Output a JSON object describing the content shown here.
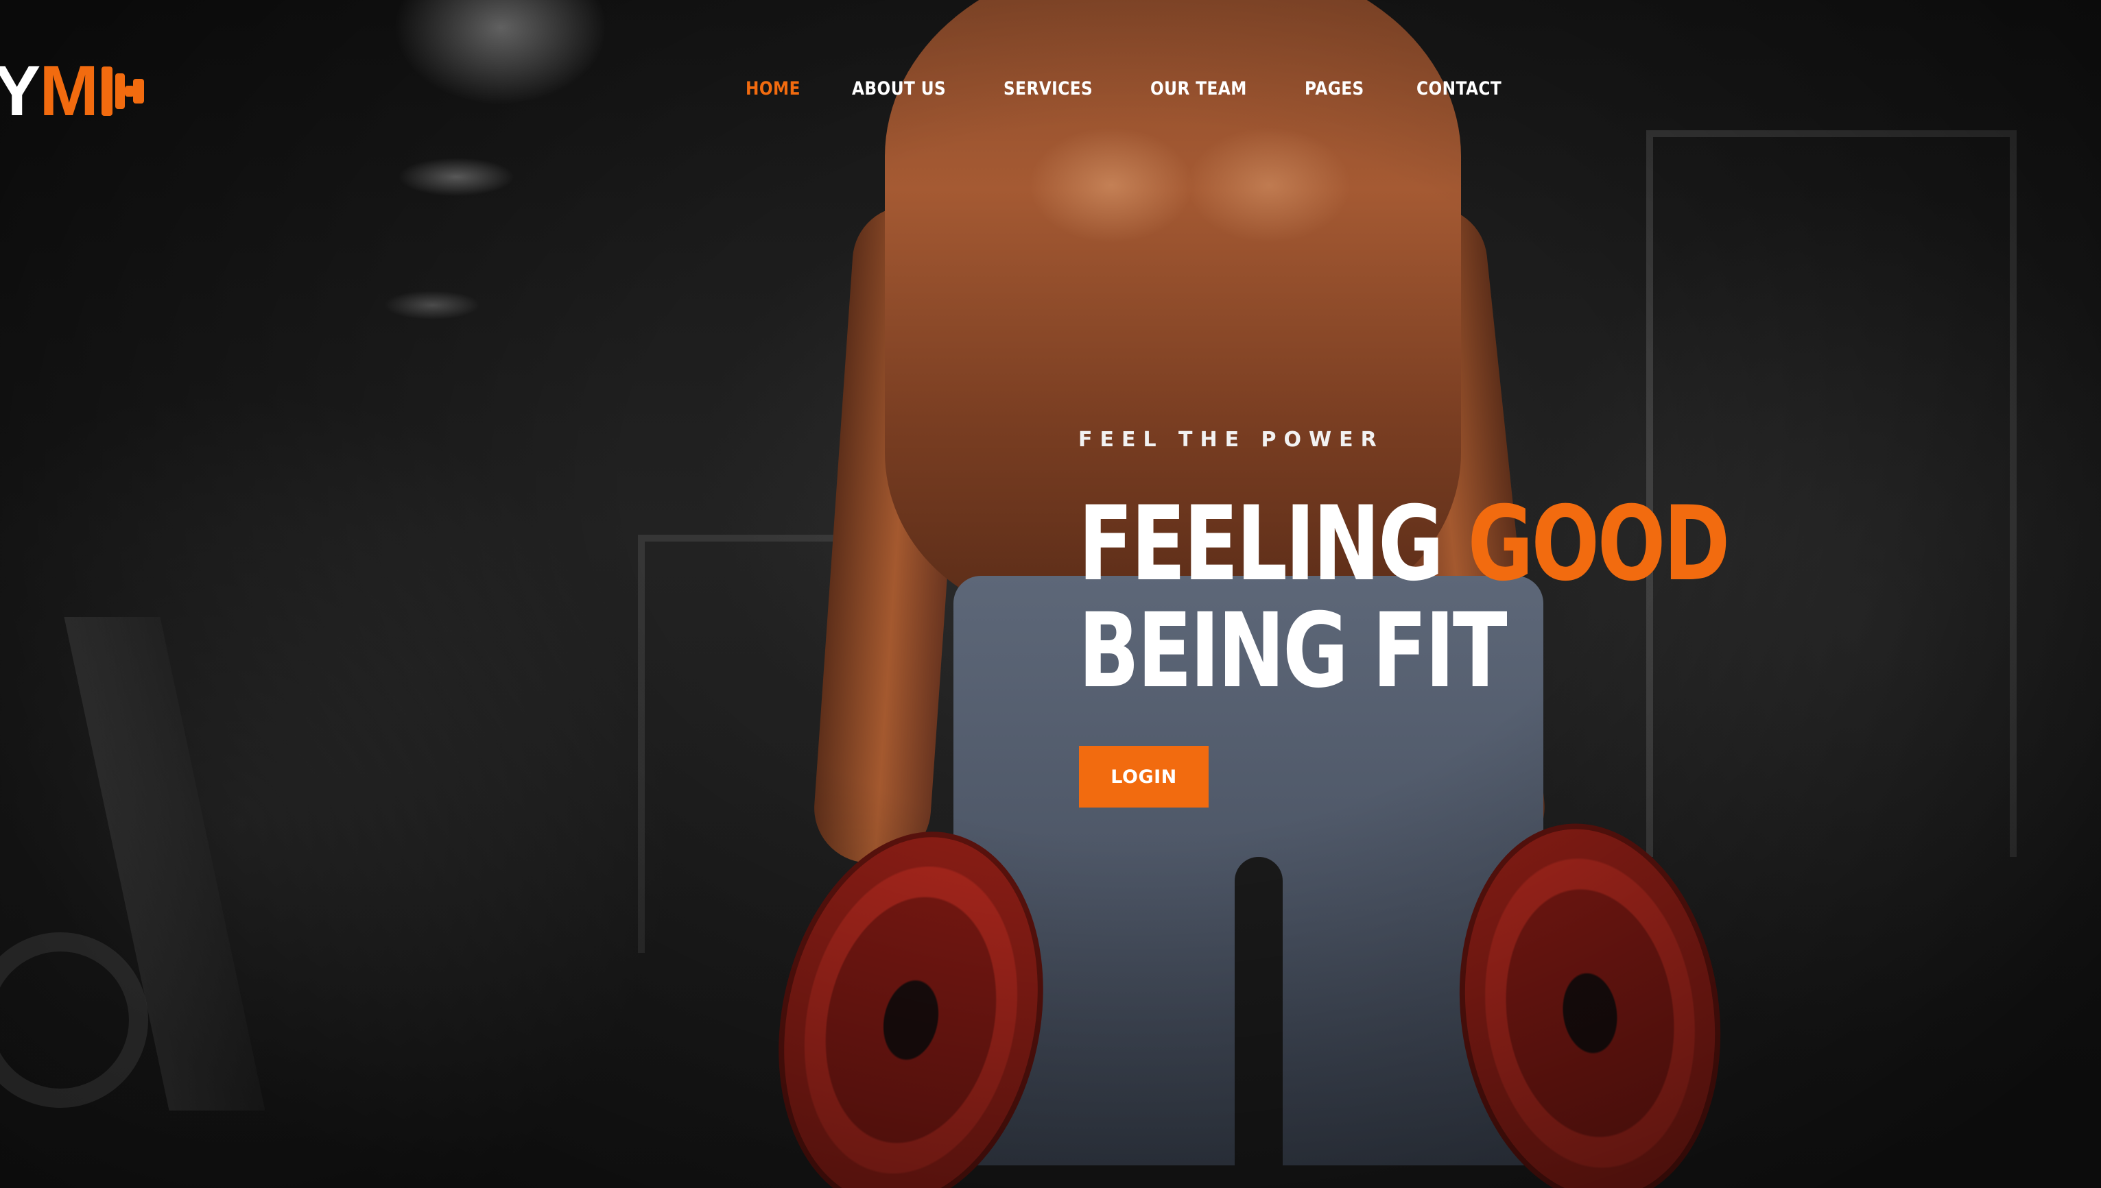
{
  "brand": {
    "logo_text_white": "Y",
    "logo_text_orange": "M",
    "logo_icon": "dumbbell-icon"
  },
  "nav": {
    "items": [
      {
        "label": "HOME",
        "active": true
      },
      {
        "label": "ABOUT US",
        "active": false
      },
      {
        "label": "SERVICES",
        "active": false
      },
      {
        "label": "OUR TEAM",
        "active": false
      },
      {
        "label": "PAGES",
        "active": false
      },
      {
        "label": "CONTACT",
        "active": false
      }
    ]
  },
  "hero": {
    "kicker": "FEEL THE POWER",
    "title_line1_white": "FEELING ",
    "title_line1_accent": "GOOD",
    "title_line2": "BEING FIT",
    "button_label": "LOGIN"
  },
  "colors": {
    "accent": "#f26b0f",
    "text": "#ffffff",
    "background": "#1a1a1a"
  }
}
